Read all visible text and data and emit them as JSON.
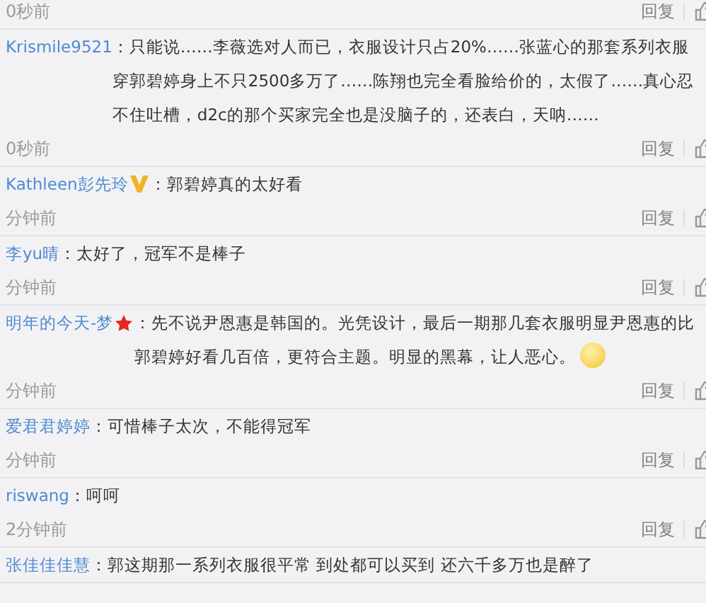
{
  "top_meta": {
    "time": "0秒前",
    "reply": "回复"
  },
  "comments": [
    {
      "user": "Krismile9521",
      "verified": false,
      "starred": false,
      "text": "：只能说……李薇选对人而已，衣服设计只占20%……张蓝心的那套系列衣服穿郭碧婷身上不只2500多万了……陈翔也完全看脸给价的，太假了……真心忍不住吐槽，d2c的那个买家完全也是没脑子的，还表白，天呐……",
      "emoticon": false,
      "time": "0秒前",
      "reply": "回复"
    },
    {
      "user": "Kathleen彭先玲",
      "verified": true,
      "starred": false,
      "text": "：郭碧婷真的太好看",
      "emoticon": false,
      "time": "分钟前",
      "reply": "回复"
    },
    {
      "user": "李yu晴",
      "verified": false,
      "starred": false,
      "text": "：太好了，冠军不是棒子",
      "emoticon": false,
      "time": "分钟前",
      "reply": "回复"
    },
    {
      "user": "明年的今天-梦",
      "verified": false,
      "starred": true,
      "text": "：先不说尹恩惠是韩国的。光凭设计，最后一期那几套衣服明显尹恩惠的比郭碧婷好看几百倍，更符合主题。明显的黑幕，让人恶心。",
      "emoticon": true,
      "time": "分钟前",
      "reply": "回复"
    },
    {
      "user": "爱君君婷婷",
      "verified": false,
      "starred": false,
      "text": "：可惜棒子太次，不能得冠军",
      "emoticon": false,
      "time": "分钟前",
      "reply": "回复"
    },
    {
      "user": "riswang",
      "verified": false,
      "starred": false,
      "text": "：呵呵",
      "emoticon": false,
      "time": "2分钟前",
      "reply": "回复"
    },
    {
      "user": "张佳佳佳慧",
      "verified": false,
      "starred": false,
      "text": "：郭这期那一系列衣服很平常 到处都可以买到 还六千多万也是醉了",
      "emoticon": false
    }
  ]
}
